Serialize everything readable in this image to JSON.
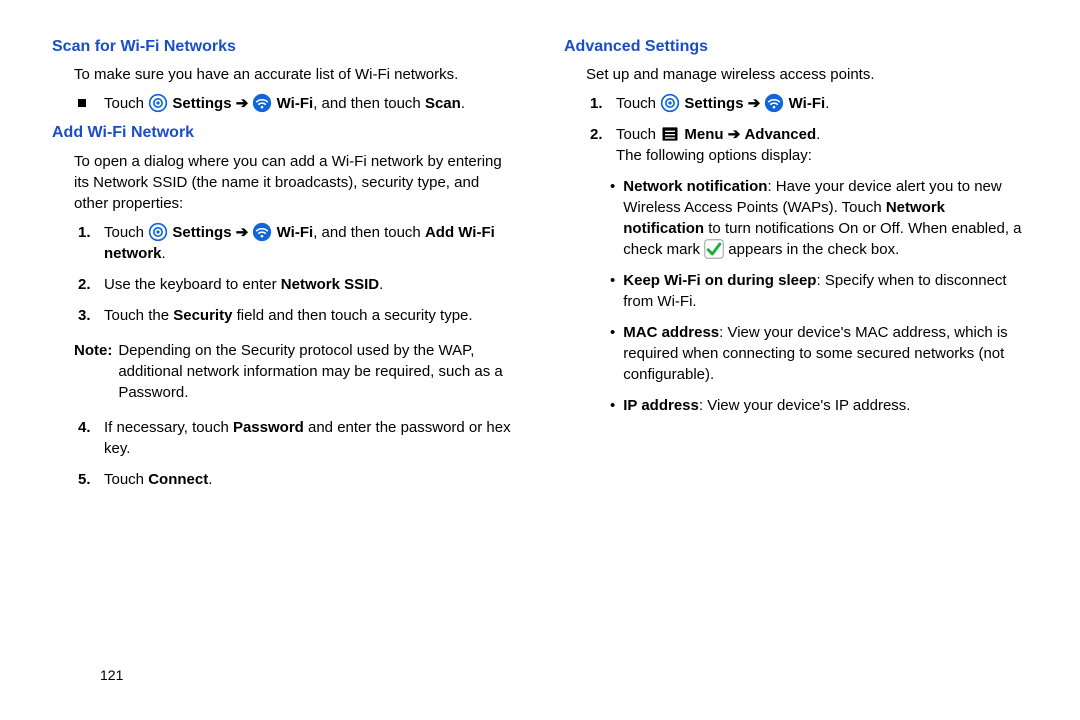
{
  "page_number": "121",
  "arrow": "➔",
  "left": {
    "scan_title": "Scan for Wi-Fi Networks",
    "scan_intro": "To make sure you have an accurate list of Wi-Fi networks.",
    "scan_b1_pre": "Touch ",
    "scan_b1_settings": "Settings",
    "scan_b1_wifi": "Wi-Fi",
    "scan_b1_midthen": ", and then touch ",
    "scan_b1_scan": "Scan",
    "add_title": "Add Wi-Fi Network",
    "add_intro": "To open a dialog where you can add a Wi-Fi network by entering its Network SSID (the name it broadcasts), security type, and other properties:",
    "s1_pre": "Touch ",
    "s1_settings": "Settings",
    "s1_wifi": "Wi-Fi",
    "s1_midthen": ", and then touch ",
    "s1_add": "Add Wi-Fi network",
    "s2_pre": "Use the keyboard to enter ",
    "s2_ssid": "Network SSID",
    "s3_pre": "Touch the ",
    "s3_sec": "Security",
    "s3_post": " field and then touch a security type.",
    "note_label": "Note:",
    "note_body": "Depending on the Security protocol used by the WAP, additional network information may be required, such as a Password.",
    "s4_pre": "If necessary, touch ",
    "s4_pwd": "Password",
    "s4_post": " and enter the password or hex key.",
    "s5_pre": "Touch ",
    "s5_conn": "Connect"
  },
  "right": {
    "adv_title": "Advanced Settings",
    "adv_intro": "Set up and manage wireless access points.",
    "r1_pre": "Touch ",
    "r1_settings": "Settings",
    "r1_wifi": "Wi-Fi",
    "r2_pre": "Touch ",
    "r2_menu": "Menu",
    "r2_adv": "Advanced",
    "r2_follow": "The following options display:",
    "b1_label": "Network notification",
    "b1_text1": ": Have your device alert you to new Wireless Access Points (WAPs). Touch ",
    "b1_netnotif": "Network notification",
    "b1_text2": " to turn notifications On or Off. When enabled, a check mark ",
    "b1_text3": " appears in the check box.",
    "b2_label": "Keep Wi-Fi on during sleep",
    "b2_text": ": Specify when to disconnect from Wi-Fi.",
    "b3_label": "MAC address",
    "b3_text": ": View your device's MAC address, which is required when connecting to some secured networks (not configurable).",
    "b4_label": "IP address",
    "b4_text": ": View your device's IP address."
  }
}
